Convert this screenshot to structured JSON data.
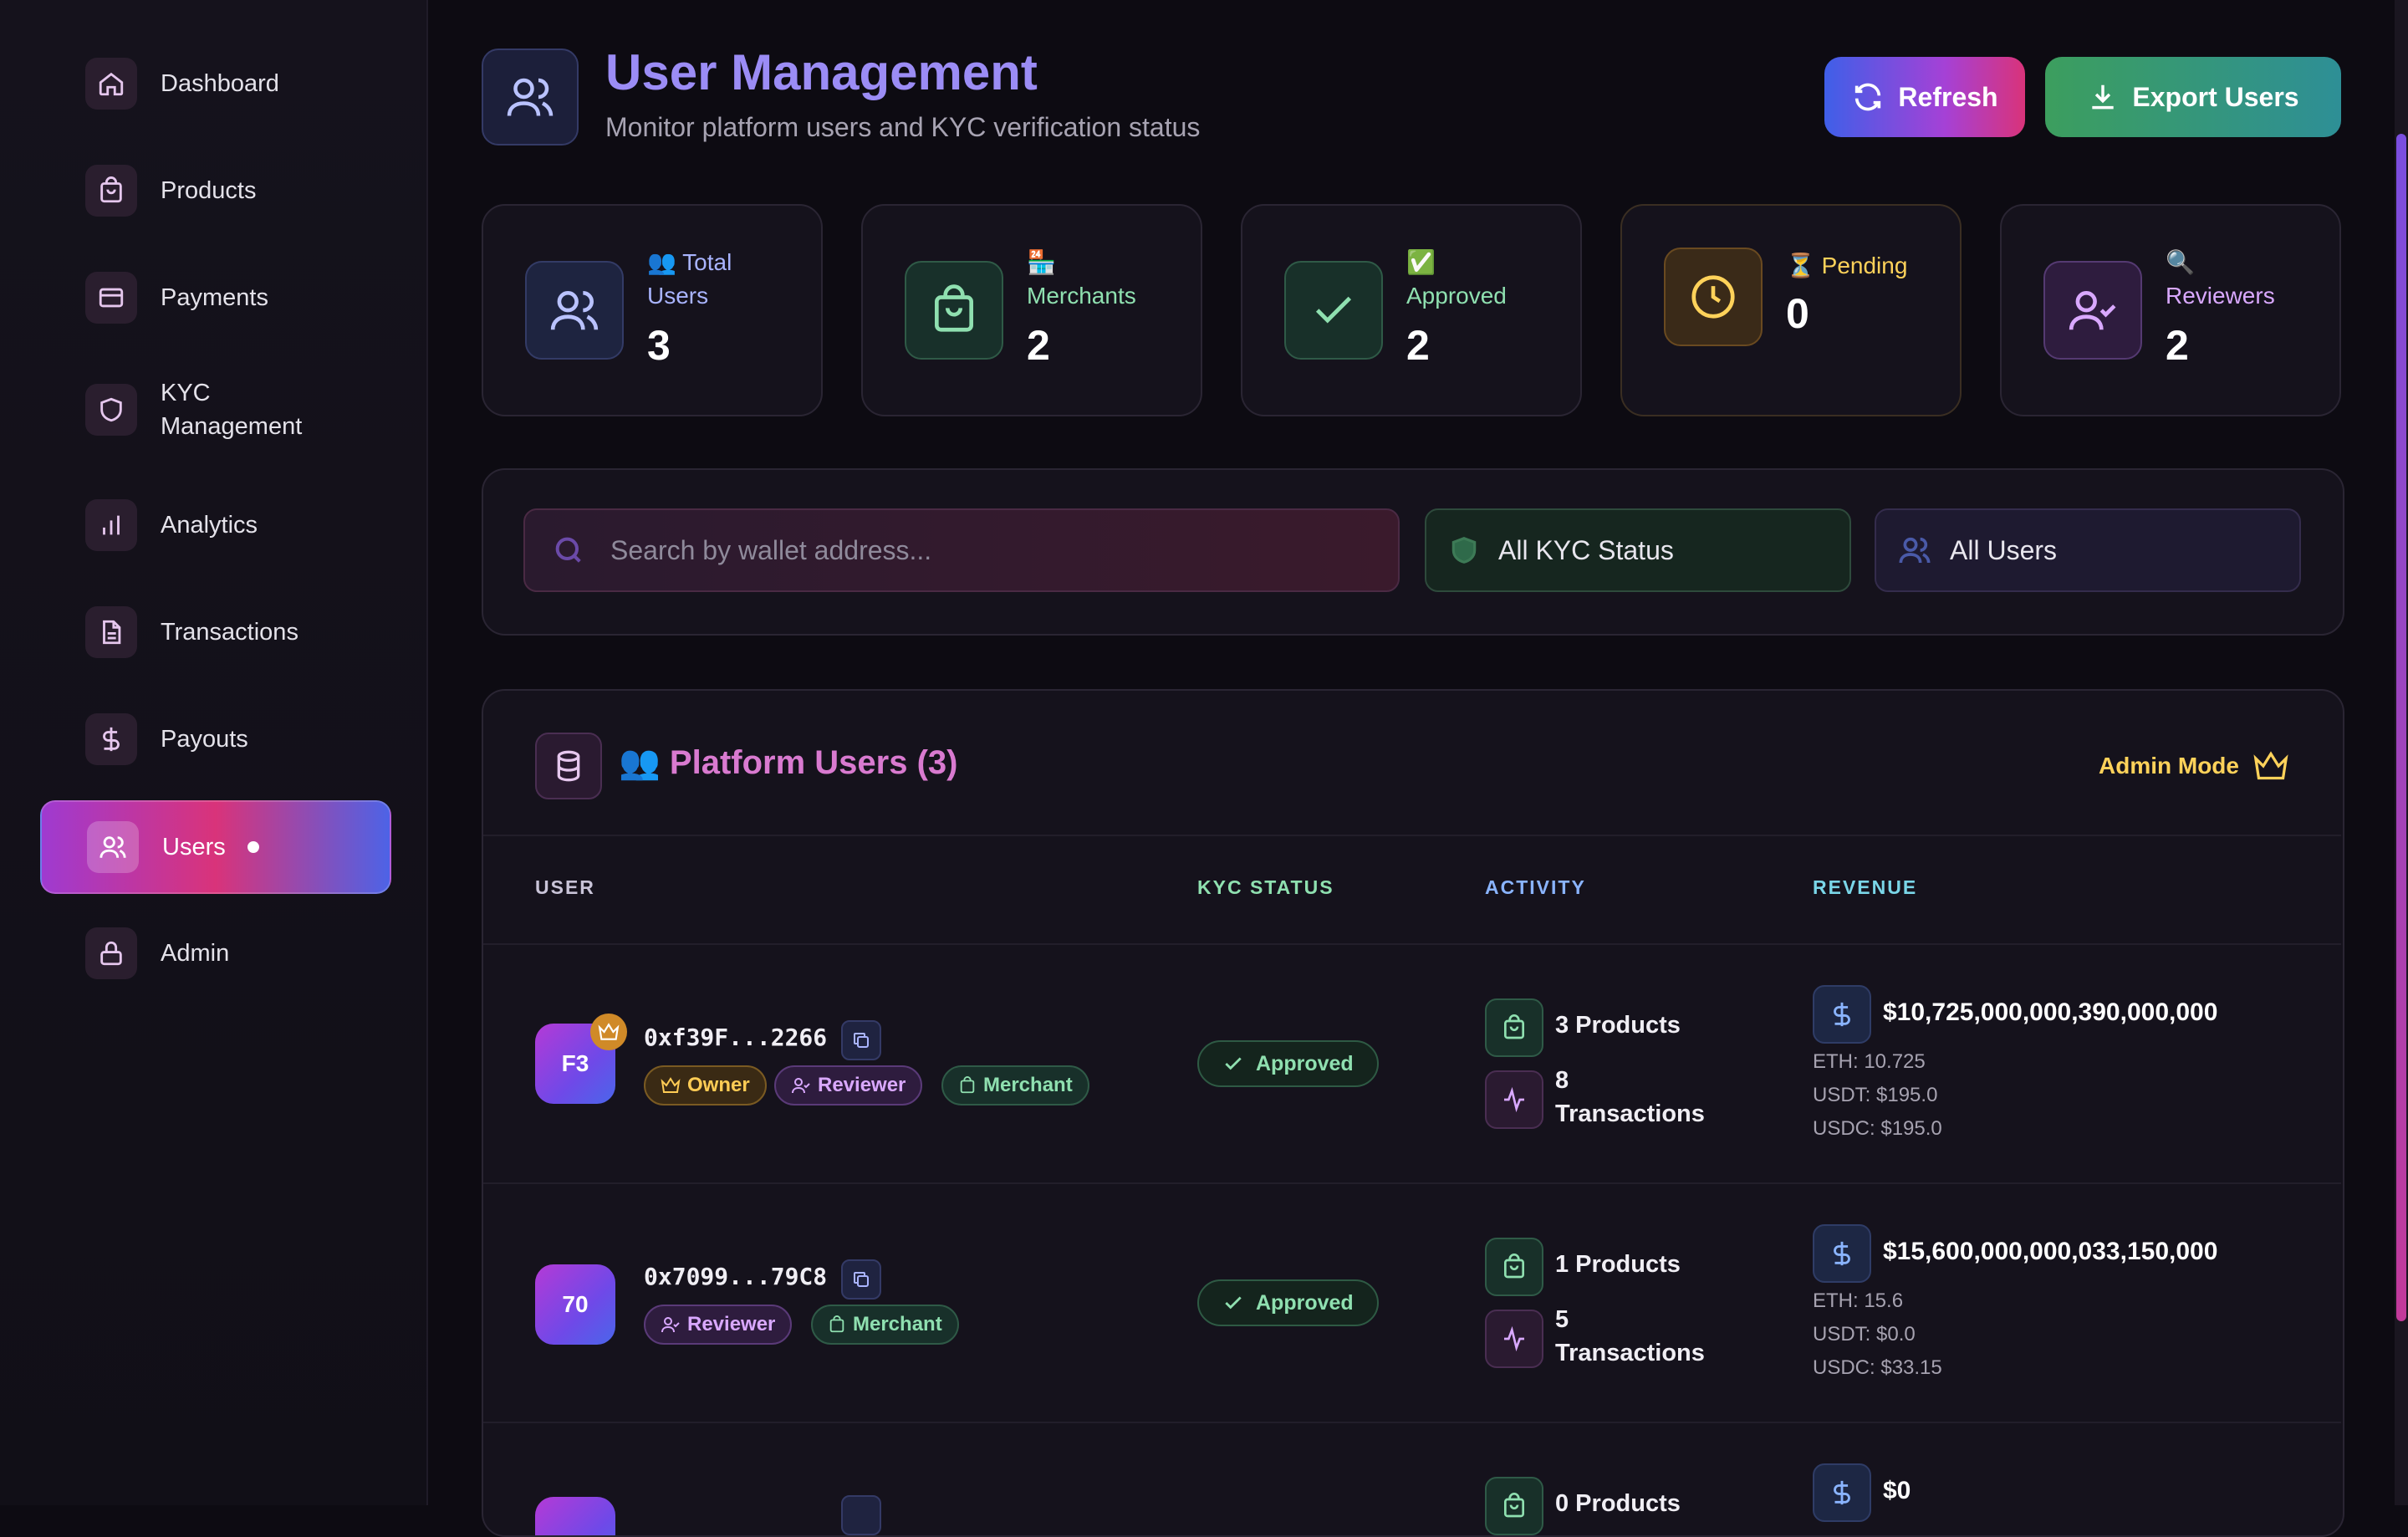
{
  "sidebar": {
    "items": [
      {
        "label": "Dashboard",
        "icon": "home-icon"
      },
      {
        "label": "Products",
        "icon": "bag-icon"
      },
      {
        "label": "Payments",
        "icon": "credit-card-icon"
      },
      {
        "label": "KYC Management",
        "label_line1": "KYC",
        "label_line2": "Management",
        "icon": "shield-icon"
      },
      {
        "label": "Analytics",
        "icon": "bar-chart-icon"
      },
      {
        "label": "Transactions",
        "icon": "document-icon"
      },
      {
        "label": "Payouts",
        "icon": "dollar-icon"
      },
      {
        "label": "Users",
        "icon": "users-icon",
        "active": true
      },
      {
        "label": "Admin",
        "icon": "lock-icon"
      }
    ]
  },
  "header": {
    "title": "User Management",
    "subtitle": "Monitor platform users and KYC verification status",
    "refresh_label": "Refresh",
    "export_label": "Export Users"
  },
  "stats": [
    {
      "emoji": "👥",
      "label": "Total Users",
      "label_line1": "Total",
      "label_line2": "Users",
      "value": "3",
      "color": "#a9b4ff"
    },
    {
      "emoji": "🏪",
      "label": "Merchants",
      "value": "2",
      "color": "#8fe0b0"
    },
    {
      "emoji": "✅",
      "label": "Approved",
      "value": "2",
      "color": "#8fe0b0"
    },
    {
      "emoji": "⏳",
      "label": "Pending",
      "value": "0",
      "color": "#ffd25a"
    },
    {
      "emoji": "🔍",
      "label": "Reviewers",
      "value": "2",
      "color": "#d9a8ff"
    }
  ],
  "filters": {
    "search_placeholder": "Search by wallet address...",
    "kyc_status": "All KYC Status",
    "user_type": "All Users"
  },
  "table": {
    "title": "👥 Platform Users (3)",
    "admin_mode_label": "Admin Mode",
    "columns": [
      "USER",
      "KYC STATUS",
      "ACTIVITY",
      "REVENUE"
    ],
    "rows": [
      {
        "initials": "F3",
        "address": "0xf39F...2266",
        "is_owner": true,
        "tags": [
          "Owner",
          "Reviewer",
          "Merchant"
        ],
        "kyc_status": "Approved",
        "products": "3 Products",
        "transactions": "8",
        "transactions_label": "Transactions",
        "revenue": "$10,725,000,000,390,000,000",
        "eth": "ETH: 10.725",
        "usdt": "USDT: $195.0",
        "usdc": "USDC: $195.0"
      },
      {
        "initials": "70",
        "address": "0x7099...79C8",
        "tags": [
          "Reviewer",
          "Merchant"
        ],
        "kyc_status": "Approved",
        "products": "1 Products",
        "transactions": "5",
        "transactions_label": "Transactions",
        "revenue": "$15,600,000,000,033,150,000",
        "eth": "ETH: 15.6",
        "usdt": "USDT: $0.0",
        "usdc": "USDC: $33.15"
      },
      {
        "products": "0 Products",
        "revenue": "$0"
      }
    ]
  },
  "colors": {
    "accent_purple": "#9b8cf5",
    "accent_pink": "#e0468c",
    "success": "#8fe0b0",
    "warning": "#ffd25a"
  }
}
